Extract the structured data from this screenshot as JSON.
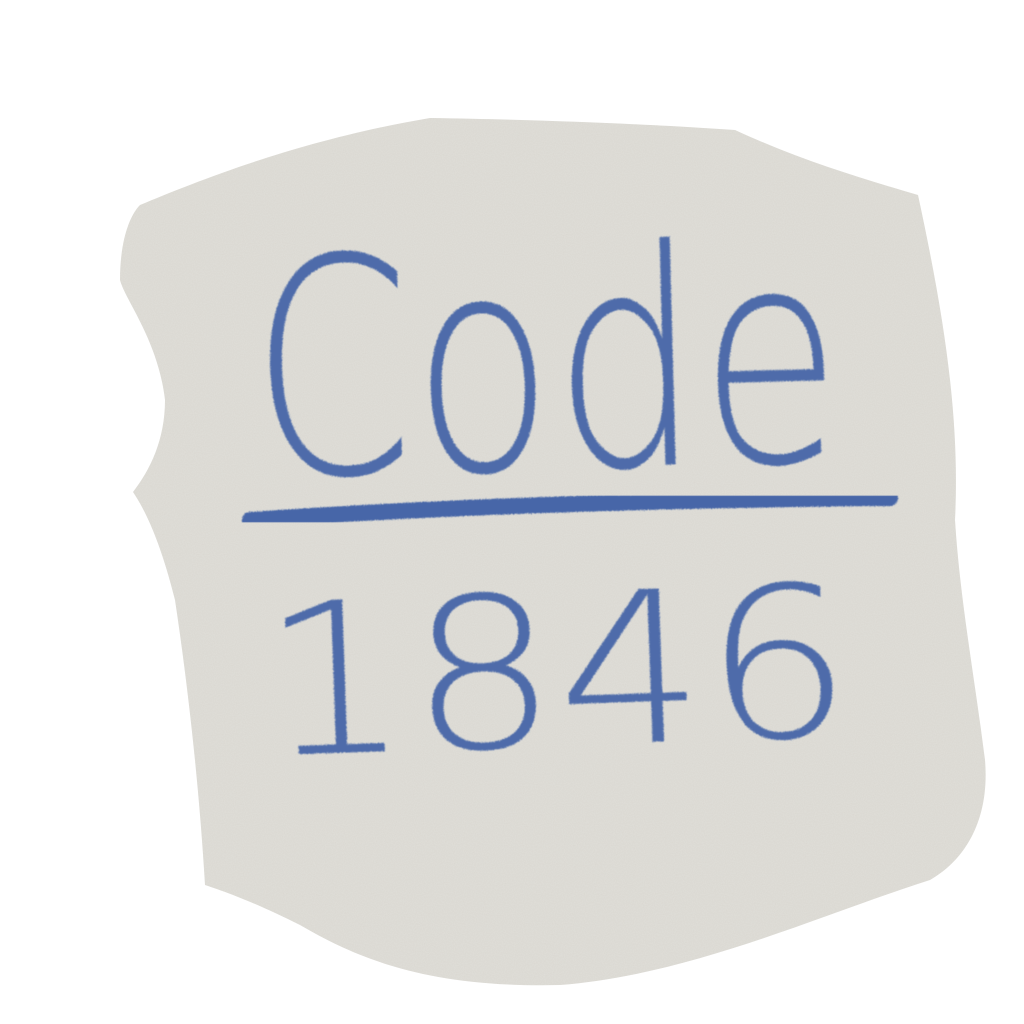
{
  "note": {
    "word": "Code",
    "number": "1846"
  },
  "colors": {
    "paper": "#d9d7d0",
    "ink": "#4666a8",
    "background": "#ffffff"
  }
}
